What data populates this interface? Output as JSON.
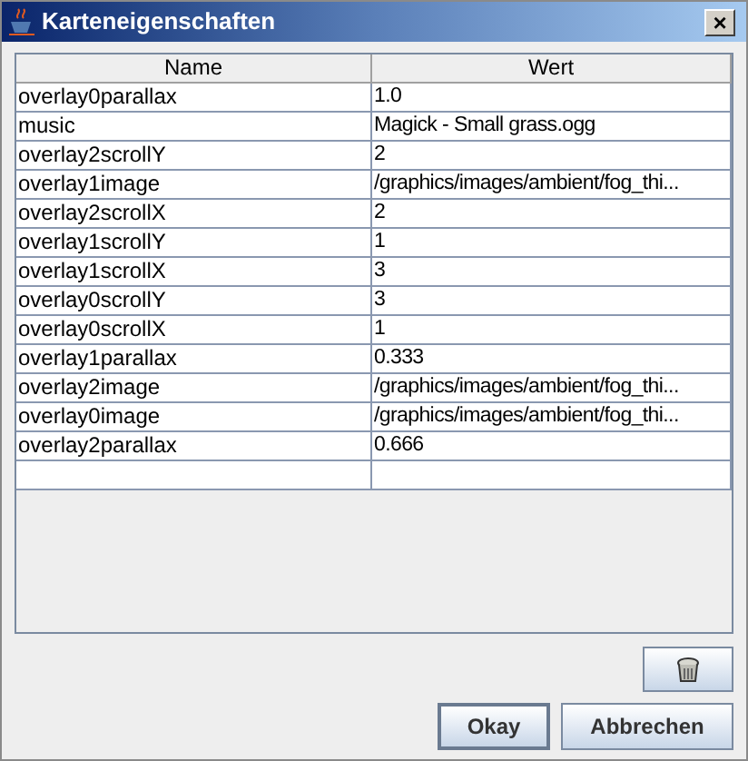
{
  "window": {
    "title": "Karteneigenschaften",
    "close": "×"
  },
  "table": {
    "columns": [
      "Name",
      "Wert"
    ],
    "rows": [
      [
        "overlay0parallax",
        "1.0"
      ],
      [
        "music",
        "Magick - Small grass.ogg"
      ],
      [
        "overlay2scrollY",
        "2"
      ],
      [
        "overlay1image",
        "/graphics/images/ambient/fog_thi..."
      ],
      [
        "overlay2scrollX",
        "2"
      ],
      [
        "overlay1scrollY",
        "1"
      ],
      [
        "overlay1scrollX",
        "3"
      ],
      [
        "overlay0scrollY",
        "3"
      ],
      [
        "overlay0scrollX",
        "1"
      ],
      [
        "overlay1parallax",
        "0.333"
      ],
      [
        "overlay2image",
        "/graphics/images/ambient/fog_thi..."
      ],
      [
        "overlay0image",
        "/graphics/images/ambient/fog_thi..."
      ],
      [
        "overlay2parallax",
        "0.666"
      ],
      [
        "",
        ""
      ]
    ]
  },
  "buttons": [
    {
      "label": "Okay",
      "selected": true
    },
    {
      "label": "Abbrechen",
      "selected": false
    }
  ]
}
